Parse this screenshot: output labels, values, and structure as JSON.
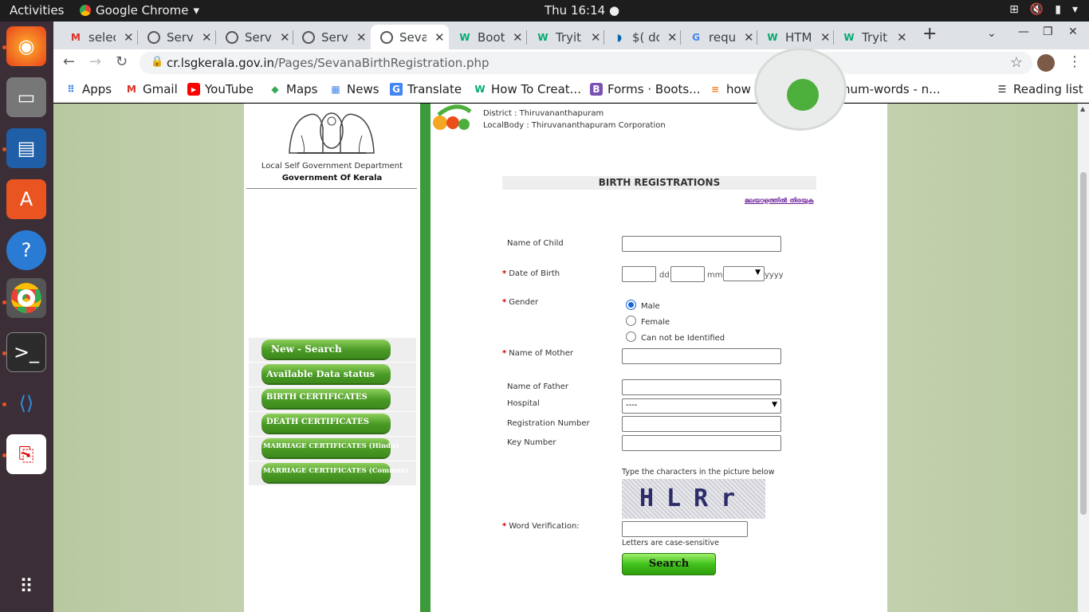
{
  "topbar": {
    "activities": "Activities",
    "app_name": "Google Chrome",
    "clock": "Thu 16:14 ●"
  },
  "tabs": [
    {
      "title": "selec",
      "icon": "gmail-icon"
    },
    {
      "title": "Servi",
      "icon": "globe-icon"
    },
    {
      "title": "Servi",
      "icon": "globe-icon"
    },
    {
      "title": "Servi",
      "icon": "globe-icon"
    },
    {
      "title": "Seva",
      "icon": "globe-icon"
    },
    {
      "title": "Boot",
      "icon": "w-icon"
    },
    {
      "title": "Tryit",
      "icon": "w-icon"
    },
    {
      "title": "$( do",
      "icon": "jquery-icon"
    },
    {
      "title": "requ",
      "icon": "google-icon"
    },
    {
      "title": "HTM",
      "icon": "w-icon"
    },
    {
      "title": "Tryit",
      "icon": "w-icon"
    }
  ],
  "address": {
    "domain": "cr.lsgkerala.gov.in",
    "path": "/Pages/SevanaBirthRegistration.php"
  },
  "bookmarks": [
    {
      "label": "Apps",
      "icon": "apps-grid-icon"
    },
    {
      "label": "Gmail",
      "icon": "gmail-icon"
    },
    {
      "label": "YouTube",
      "icon": "youtube-icon"
    },
    {
      "label": "Maps",
      "icon": "maps-icon"
    },
    {
      "label": "News",
      "icon": "news-icon"
    },
    {
      "label": "Translate",
      "icon": "translate-icon"
    },
    {
      "label": "How To Creat...",
      "icon": "w-icon"
    },
    {
      "label": "Forms · Boots...",
      "icon": "bootstrap-icon"
    },
    {
      "label": "how to recalc...",
      "icon": "stackoverflow-icon"
    },
    {
      "label": "num-words - n...",
      "icon": "npm-icon"
    }
  ],
  "reading_list": "Reading list",
  "sidebar": {
    "dept": "Local Self Government Department",
    "gov": "Government Of Kerala",
    "menu": [
      "New - Search",
      "Available Data status",
      "BIRTH CERTIFICATES",
      "DEATH CERTIFICATES",
      "MARRIAGE CERTIFICATES (Hindu)",
      "MARRIAGE CERTIFICATES (Common)"
    ]
  },
  "header": {
    "district": "District : Thiruvananthapuram",
    "localbody": "LocalBody : Thiruvananthapuram Corporation"
  },
  "form": {
    "title": "BIRTH REGISTRATIONS",
    "malayalam_link": "മലയാളത്തിൽ തിരയുക",
    "name_child": "Name of Child",
    "dob": "Date of Birth",
    "dd": "dd",
    "mm": "mm",
    "yyyy": "yyyy",
    "gender": "Gender",
    "gender_options": [
      "Male",
      "Female",
      "Can not be Identified"
    ],
    "gender_selected": "Male",
    "mother": "Name of Mother",
    "father": "Name of Father",
    "hospital": "Hospital",
    "hospital_value": "----",
    "reg_no": "Registration Number",
    "key_no": "Key Number",
    "captcha_hint": "Type the characters in the picture below",
    "captcha_text": "HLRr",
    "word_verification": "Word Verification:",
    "case_note": "Letters are case-sensitive",
    "search_button": "Search"
  },
  "colors": {
    "accent_green": "#3c9a3a",
    "required": "#cc0000",
    "link": "#6a1b9a"
  }
}
